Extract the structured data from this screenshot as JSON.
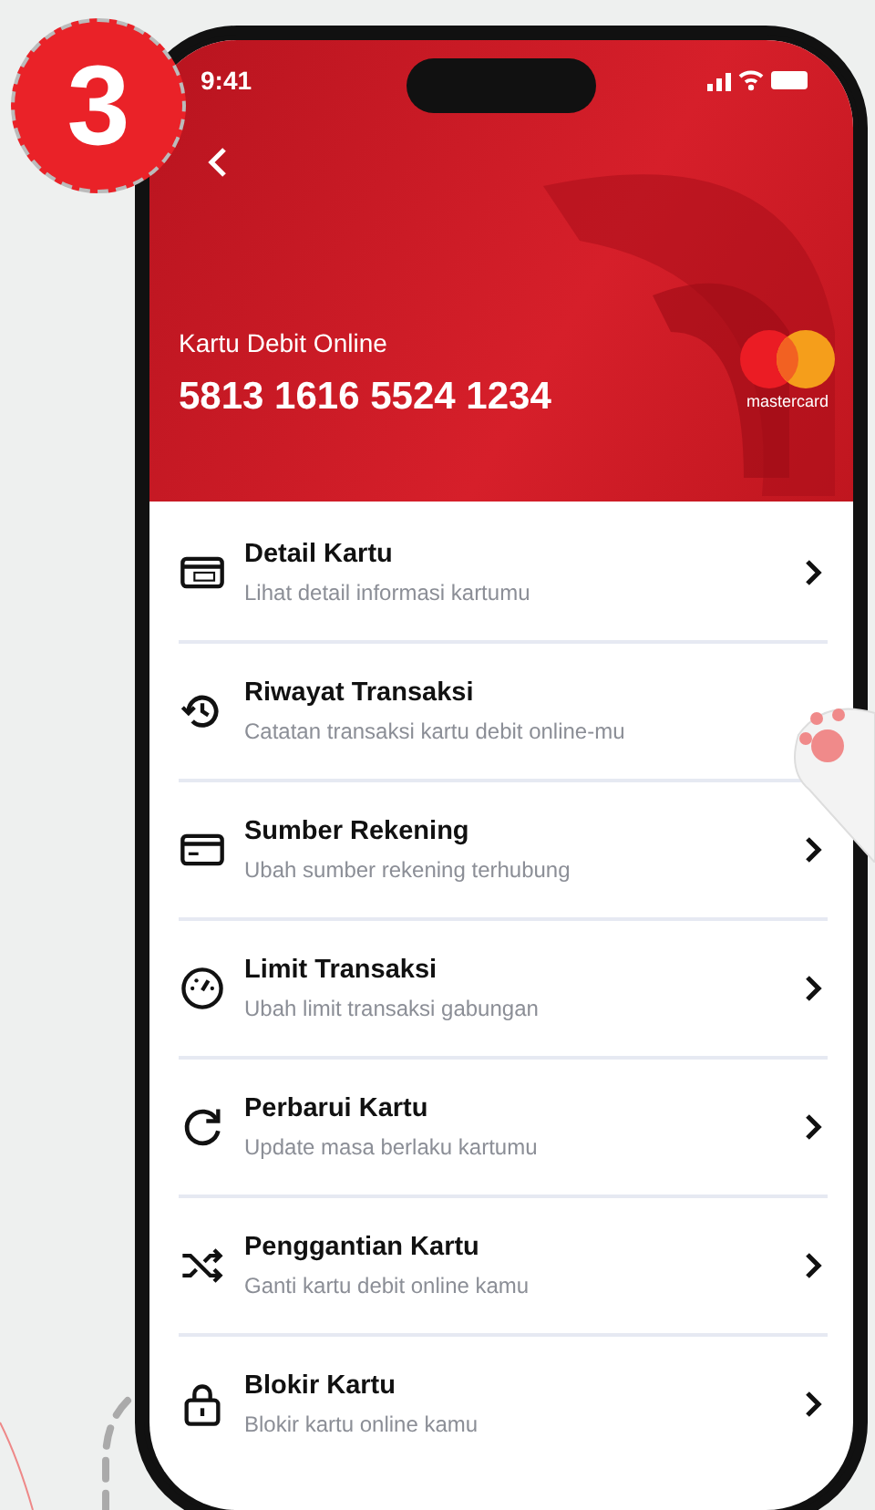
{
  "step_badge": "3",
  "status_bar": {
    "time": "9:41"
  },
  "card": {
    "label": "Kartu Debit Online",
    "number": "5813 1616 5524 1234",
    "brand": "mastercard"
  },
  "menu_items": [
    {
      "title": "Detail Kartu",
      "subtitle": "Lihat detail informasi kartumu",
      "chevron": true
    },
    {
      "title": "Riwayat Transaksi",
      "subtitle": "Catatan transaksi kartu debit online-mu",
      "chevron": false
    },
    {
      "title": "Sumber Rekening",
      "subtitle": "Ubah sumber rekening terhubung",
      "chevron": true
    },
    {
      "title": "Limit Transaksi",
      "subtitle": "Ubah limit transaksi gabungan",
      "chevron": true
    },
    {
      "title": "Perbarui Kartu",
      "subtitle": "Update masa berlaku kartumu",
      "chevron": true
    },
    {
      "title": "Penggantian Kartu",
      "subtitle": "Ganti kartu debit online kamu",
      "chevron": true
    },
    {
      "title": "Blokir Kartu",
      "subtitle": "Blokir kartu online kamu",
      "chevron": true
    }
  ]
}
